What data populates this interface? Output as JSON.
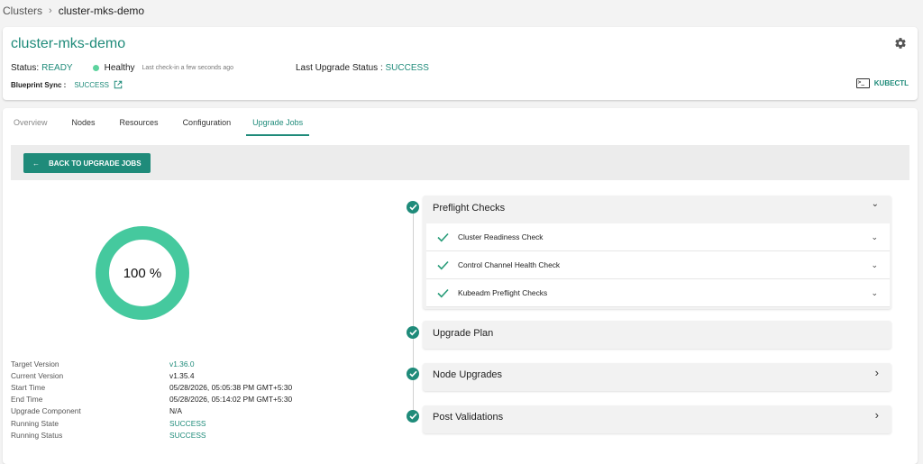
{
  "breadcrumb": {
    "root": "Clusters",
    "separator": "›",
    "current": "cluster-mks-demo"
  },
  "cluster": {
    "title": "cluster-mks-demo",
    "status_label": "Status:",
    "status_value": "READY",
    "health_label": "Healthy",
    "last_check": "Last check-in a few seconds ago",
    "upgrade_status_label": "Last Upgrade Status :",
    "upgrade_status_value": "SUCCESS",
    "blueprint_label": "Blueprint Sync :",
    "blueprint_value": "SUCCESS",
    "kubectl_label": "KUBECTL",
    "kubectl_icon_text": ">_"
  },
  "tabs": [
    "Overview",
    "Nodes",
    "Resources",
    "Configuration",
    "Upgrade Jobs"
  ],
  "active_tab": "Upgrade Jobs",
  "toolbar": {
    "back_arrow": "←",
    "back_label": "BACK TO UPGRADE JOBS"
  },
  "progress": {
    "percent": 100,
    "label": "100 %"
  },
  "details": [
    {
      "label": "Target Version",
      "value": "v1.36.0"
    },
    {
      "label": "Current Version",
      "value": "v1.35.4"
    },
    {
      "label": "Start Time",
      "value": "05/28/2026, 05:05:38 PM GMT+5:30"
    },
    {
      "label": "End Time",
      "value": "05/28/2026, 05:14:02 PM GMT+5:30"
    },
    {
      "label": "Upgrade Component",
      "value": "N/A"
    },
    {
      "label": "Running State",
      "value": "SUCCESS"
    },
    {
      "label": "Running Status",
      "value": "SUCCESS"
    }
  ],
  "steps": {
    "preflight": {
      "title": "Preflight Checks",
      "checks": [
        "Cluster Readiness Check",
        "Control Channel Health Check",
        "Kubeadm Preflight Checks"
      ]
    },
    "upgrade_plan": {
      "title": "Upgrade Plan"
    },
    "node_upgrades": {
      "title": "Node Upgrades"
    },
    "post_validations": {
      "title": "Post Validations"
    }
  },
  "icons": {
    "chevron_down": "⌄",
    "chevron_right": "›"
  },
  "colors": {
    "accent": "#1f8b7a",
    "progress_ring": "#45c99e",
    "health_dot": "#5dd39e"
  }
}
